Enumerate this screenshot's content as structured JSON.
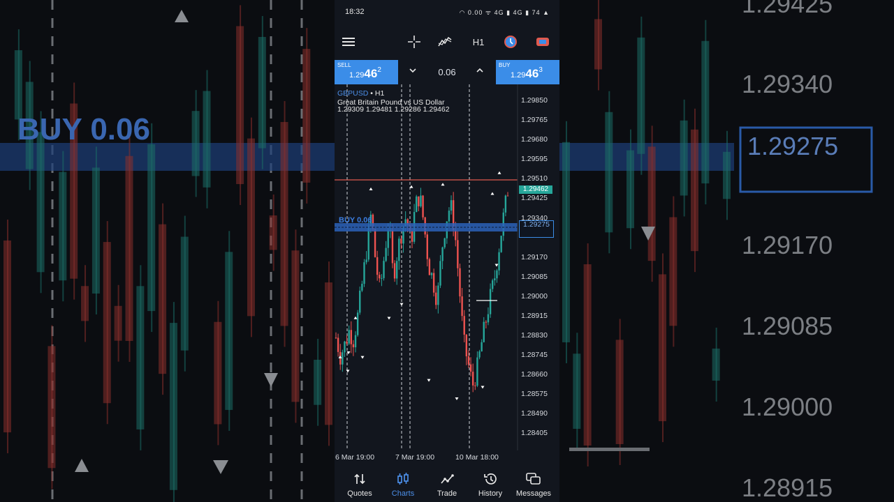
{
  "status_bar": {
    "time": "18:32",
    "icons_text": "◠ 0.00 ᯤ 4G ▮ 4G ▮ 74 ▲",
    "battery": "74"
  },
  "toolbar": {
    "menu_icon": "hamburger-icon",
    "crosshair_icon": "crosshair-icon",
    "indicators_icon": "indicators-icon",
    "timeframe": "H1",
    "clock_icon": "clock-icon",
    "trade_icon": "trade-icon"
  },
  "price_bar": {
    "sell_label": "SELL",
    "sell_prefix": "1.29",
    "sell_big": "46",
    "sell_sup": "2",
    "lot_value": "0.06",
    "buy_label": "BUY",
    "buy_prefix": "1.29",
    "buy_big": "46",
    "buy_sup": "3"
  },
  "chart": {
    "symbol": "GBPUSD",
    "timeframe_sep": "• H1",
    "description": "Great Britain Pound vs US Dollar",
    "ohlc": "1.29309 1.29481 1.29286 1.29462",
    "current_price_badge": "1.29462",
    "buy_order_label": "BUY 0.06",
    "buy_order_price": "1.29275",
    "y_ticks": [
      "1.29850",
      "1.29765",
      "1.29680",
      "1.29595",
      "1.29510",
      "1.29425",
      "1.29340",
      "1.29275",
      "1.29170",
      "1.29085",
      "1.29000",
      "1.28915",
      "1.28830",
      "1.28745",
      "1.28660",
      "1.28575",
      "1.28490",
      "1.28405"
    ],
    "x_labels": [
      "6 Mar 19:00",
      "7 Mar 19:00",
      "10 Mar 18:00"
    ],
    "colors": {
      "bull": "#26a69a",
      "bear": "#ef5350",
      "accent": "#3b8de8",
      "price_line": "#e05a4f"
    }
  },
  "chart_data": {
    "type": "candlestick",
    "symbol": "GBPUSD",
    "timeframe": "H1",
    "ylim": [
      1.2833,
      1.2992
    ],
    "x": [
      "6 Mar 19:00",
      "7 Mar 19:00",
      "10 Mar 18:00"
    ],
    "close_path": [
      1.2882,
      1.2874,
      1.2879,
      1.2885,
      1.2881,
      1.2892,
      1.2906,
      1.2921,
      1.2936,
      1.2915,
      1.2902,
      1.2918,
      1.2933,
      1.2908,
      1.292,
      1.2929,
      1.2935,
      1.2922,
      1.2939,
      1.2944,
      1.2931,
      1.2914,
      1.2907,
      1.2898,
      1.292,
      1.2933,
      1.294,
      1.2928,
      1.2904,
      1.288,
      1.2871,
      1.2861,
      1.2868,
      1.2879,
      1.2889,
      1.2899,
      1.2908,
      1.2921,
      1.2934,
      1.2946
    ],
    "last": {
      "open": 1.29309,
      "high": 1.29481,
      "low": 1.29286,
      "close": 1.29462
    }
  },
  "nav": [
    {
      "label": "Quotes",
      "icon": "quotes-icon"
    },
    {
      "label": "Charts",
      "icon": "charts-icon"
    },
    {
      "label": "Trade",
      "icon": "trade-line-icon"
    },
    {
      "label": "History",
      "icon": "history-icon"
    },
    {
      "label": "Messages",
      "icon": "messages-icon"
    }
  ]
}
